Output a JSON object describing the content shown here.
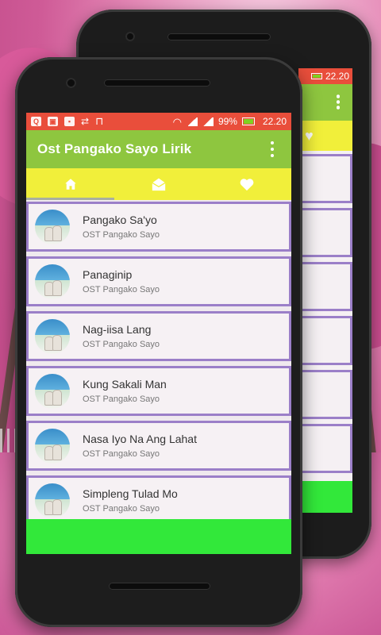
{
  "colors": {
    "status_bar": "#e94e3b",
    "app_bar": "#8ec63f",
    "tab_bar": "#f1ef3a",
    "item_border": "#9b7fc8",
    "bottom_bar": "#32e83a"
  },
  "status_bar": {
    "battery": "99%",
    "time": "22.20",
    "icons": [
      "search-icon",
      "image-icon",
      "image-icon",
      "usb-icon",
      "unlock-icon",
      "wifi-icon",
      "signal-icon",
      "signal-icon",
      "battery-charging-icon"
    ]
  },
  "back_phone": {
    "time": "22.20"
  },
  "app_bar": {
    "title": "Ost Pangako Sayo Lirik",
    "menu_icon": "overflow-menu-icon"
  },
  "tabs": [
    {
      "icon": "home-icon",
      "active": true
    },
    {
      "icon": "mail-open-icon",
      "active": false
    },
    {
      "icon": "heart-icon",
      "active": false
    }
  ],
  "songs": [
    {
      "title": "Pangako Sa'yo",
      "subtitle": "OST Pangako Sayo"
    },
    {
      "title": "Panaginip",
      "subtitle": "OST Pangako Sayo"
    },
    {
      "title": "Nag-iisa Lang",
      "subtitle": "OST Pangako Sayo"
    },
    {
      "title": "Kung Sakali Man",
      "subtitle": "OST Pangako Sayo"
    },
    {
      "title": "Nasa Iyo Na Ang Lahat",
      "subtitle": "OST Pangako Sayo"
    },
    {
      "title": "Simpleng Tulad Mo",
      "subtitle": "OST Pangako Sayo"
    }
  ]
}
